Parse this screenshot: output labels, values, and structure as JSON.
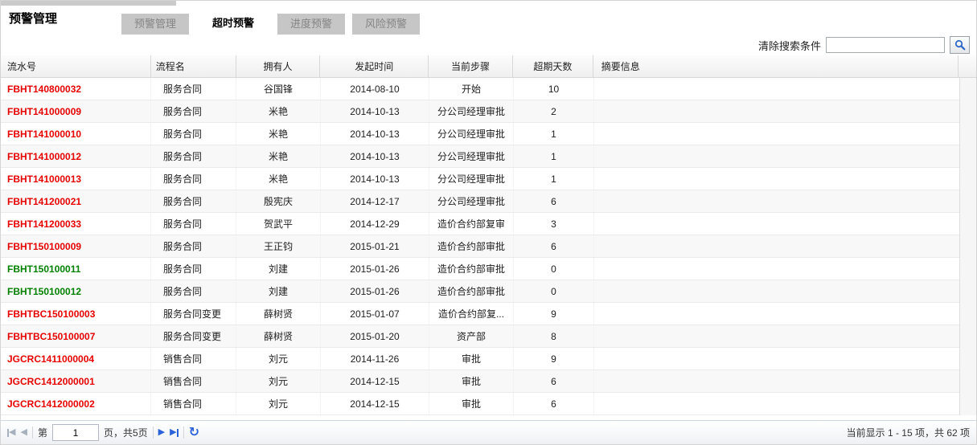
{
  "colors": {
    "serial_overdue": "#e60000",
    "serial_on_track": "#008000",
    "pager_enabled": "#2b62d9",
    "pager_disabled": "#a6b1bd",
    "accent_blue": "#2a66c8"
  },
  "page": {
    "title": "预警管理"
  },
  "tabs": [
    {
      "label": "预警管理",
      "active": false
    },
    {
      "label": "超时预警",
      "active": true
    },
    {
      "label": "进度预警",
      "active": false
    },
    {
      "label": "风险预警",
      "active": false
    }
  ],
  "search": {
    "clear_label": "清除搜索条件",
    "input_value": "",
    "icon": "magnifier-icon"
  },
  "table": {
    "columns": [
      "流水号",
      "流程名",
      "拥有人",
      "发起时间",
      "当前步骤",
      "超期天数",
      "摘要信息"
    ],
    "rows": [
      {
        "serial": "FBHT140800032",
        "state": "overdue",
        "process": "服务合同",
        "owner": "谷国锋",
        "start_time": "2014-08-10",
        "current_step": "开始",
        "overdue_days": "10",
        "summary": ""
      },
      {
        "serial": "FBHT141000009",
        "state": "overdue",
        "process": "服务合同",
        "owner": "米艳",
        "start_time": "2014-10-13",
        "current_step": "分公司经理审批",
        "overdue_days": "2",
        "summary": ""
      },
      {
        "serial": "FBHT141000010",
        "state": "overdue",
        "process": "服务合同",
        "owner": "米艳",
        "start_time": "2014-10-13",
        "current_step": "分公司经理审批",
        "overdue_days": "1",
        "summary": ""
      },
      {
        "serial": "FBHT141000012",
        "state": "overdue",
        "process": "服务合同",
        "owner": "米艳",
        "start_time": "2014-10-13",
        "current_step": "分公司经理审批",
        "overdue_days": "1",
        "summary": ""
      },
      {
        "serial": "FBHT141000013",
        "state": "overdue",
        "process": "服务合同",
        "owner": "米艳",
        "start_time": "2014-10-13",
        "current_step": "分公司经理审批",
        "overdue_days": "1",
        "summary": ""
      },
      {
        "serial": "FBHT141200021",
        "state": "overdue",
        "process": "服务合同",
        "owner": "殷宪庆",
        "start_time": "2014-12-17",
        "current_step": "分公司经理审批",
        "overdue_days": "6",
        "summary": ""
      },
      {
        "serial": "FBHT141200033",
        "state": "overdue",
        "process": "服务合同",
        "owner": "贺武平",
        "start_time": "2014-12-29",
        "current_step": "造价合约部复审",
        "overdue_days": "3",
        "summary": ""
      },
      {
        "serial": "FBHT150100009",
        "state": "overdue",
        "process": "服务合同",
        "owner": "王正钧",
        "start_time": "2015-01-21",
        "current_step": "造价合约部审批",
        "overdue_days": "6",
        "summary": ""
      },
      {
        "serial": "FBHT150100011",
        "state": "on_track",
        "process": "服务合同",
        "owner": "刘建",
        "start_time": "2015-01-26",
        "current_step": "造价合约部审批",
        "overdue_days": "0",
        "summary": ""
      },
      {
        "serial": "FBHT150100012",
        "state": "on_track",
        "process": "服务合同",
        "owner": "刘建",
        "start_time": "2015-01-26",
        "current_step": "造价合约部审批",
        "overdue_days": "0",
        "summary": ""
      },
      {
        "serial": "FBHTBC150100003",
        "state": "overdue",
        "process": "服务合同变更",
        "owner": "薛树贤",
        "start_time": "2015-01-07",
        "current_step": "造价合约部复...",
        "overdue_days": "9",
        "summary": ""
      },
      {
        "serial": "FBHTBC150100007",
        "state": "overdue",
        "process": "服务合同变更",
        "owner": "薛树贤",
        "start_time": "2015-01-20",
        "current_step": "资产部",
        "overdue_days": "8",
        "summary": ""
      },
      {
        "serial": "JGCRC1411000004",
        "state": "overdue",
        "process": "销售合同",
        "owner": "刘元",
        "start_time": "2014-11-26",
        "current_step": "审批",
        "overdue_days": "9",
        "summary": ""
      },
      {
        "serial": "JGCRC1412000001",
        "state": "overdue",
        "process": "销售合同",
        "owner": "刘元",
        "start_time": "2014-12-15",
        "current_step": "审批",
        "overdue_days": "6",
        "summary": ""
      },
      {
        "serial": "JGCRC1412000002",
        "state": "overdue",
        "process": "销售合同",
        "owner": "刘元",
        "start_time": "2014-12-15",
        "current_step": "审批",
        "overdue_days": "6",
        "summary": ""
      }
    ]
  },
  "pagination": {
    "page_prefix": "第",
    "page_input_value": "1",
    "page_suffix": "页，共5页",
    "icons": {
      "first": "first-page-icon",
      "prev": "prev-page-icon",
      "next": "next-page-icon",
      "last": "last-page-icon",
      "refresh": "refresh-icon"
    }
  },
  "status_bar": {
    "text": "当前显示 1 - 15 项，共 62 项"
  }
}
